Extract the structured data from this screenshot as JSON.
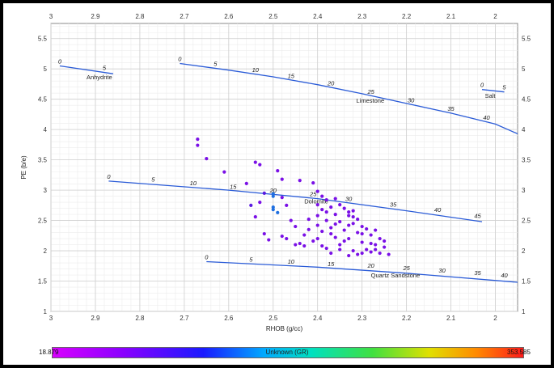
{
  "chart_data": {
    "type": "scatter",
    "title": "",
    "xlabel": "RHOB (g/cc)",
    "ylabel": "PE (b/e)",
    "xlim": [
      3.0,
      1.95
    ],
    "ylim": [
      1.0,
      5.75
    ],
    "x_ticks": [
      "3",
      "2.9",
      "2.8",
      "2.7",
      "2.6",
      "2.5",
      "2.4",
      "2.3",
      "2.2",
      "2.1",
      "2"
    ],
    "y_ticks": [
      "1",
      "1.5",
      "2",
      "2.5",
      "3",
      "3.5",
      "4",
      "4.5",
      "5",
      "5.5"
    ],
    "grid": true,
    "lithology_lines": [
      {
        "name": "Anhydrite",
        "points": [
          [
            2.98,
            5.05
          ],
          [
            2.86,
            4.92
          ]
        ],
        "labels": [
          {
            "text": "0",
            "x": 2.98,
            "y": 5.05
          },
          {
            "text": "5",
            "x": 2.88,
            "y": 4.94
          }
        ]
      },
      {
        "name": "Limestone",
        "points": [
          [
            2.71,
            5.09
          ],
          [
            2.6,
            4.98
          ],
          [
            2.5,
            4.87
          ],
          [
            2.4,
            4.74
          ],
          [
            2.3,
            4.59
          ],
          [
            2.2,
            4.43
          ],
          [
            2.1,
            4.27
          ],
          [
            2.0,
            4.09
          ],
          [
            1.95,
            3.93
          ]
        ],
        "labels": [
          {
            "text": "0",
            "x": 2.71,
            "y": 5.09
          },
          {
            "text": "5",
            "x": 2.63,
            "y": 5.01
          },
          {
            "text": "10",
            "x": 2.54,
            "y": 4.91
          },
          {
            "text": "15",
            "x": 2.46,
            "y": 4.81
          },
          {
            "text": "20",
            "x": 2.37,
            "y": 4.69
          },
          {
            "text": "25",
            "x": 2.28,
            "y": 4.55
          },
          {
            "text": "30",
            "x": 2.19,
            "y": 4.41
          },
          {
            "text": "35",
            "x": 2.1,
            "y": 4.27
          },
          {
            "text": "40",
            "x": 2.02,
            "y": 4.12
          }
        ]
      },
      {
        "name": "Salt",
        "points": [
          [
            2.03,
            4.66
          ],
          [
            1.98,
            4.62
          ]
        ],
        "labels": [
          {
            "text": "0",
            "x": 2.03,
            "y": 4.66
          },
          {
            "text": "5",
            "x": 1.98,
            "y": 4.62
          }
        ]
      },
      {
        "name": "Dolomite",
        "points": [
          [
            2.87,
            3.15
          ],
          [
            2.6,
            3.0
          ],
          [
            2.4,
            2.86
          ],
          [
            2.2,
            2.66
          ],
          [
            2.03,
            2.48
          ]
        ],
        "labels": [
          {
            "text": "0",
            "x": 2.87,
            "y": 3.15
          },
          {
            "text": "5",
            "x": 2.77,
            "y": 3.1
          },
          {
            "text": "10",
            "x": 2.68,
            "y": 3.04
          },
          {
            "text": "15",
            "x": 2.59,
            "y": 2.98
          },
          {
            "text": "20",
            "x": 2.5,
            "y": 2.92
          },
          {
            "text": "25",
            "x": 2.41,
            "y": 2.86
          },
          {
            "text": "30",
            "x": 2.33,
            "y": 2.78
          },
          {
            "text": "35",
            "x": 2.23,
            "y": 2.69
          },
          {
            "text": "40",
            "x": 2.13,
            "y": 2.6
          },
          {
            "text": "45",
            "x": 2.04,
            "y": 2.5
          }
        ]
      },
      {
        "name": "Quartz Sandstone",
        "points": [
          [
            2.65,
            1.82
          ],
          [
            2.4,
            1.73
          ],
          [
            2.2,
            1.63
          ],
          [
            1.95,
            1.48
          ]
        ],
        "labels": [
          {
            "text": "0",
            "x": 2.65,
            "y": 1.82
          },
          {
            "text": "5",
            "x": 2.55,
            "y": 1.78
          },
          {
            "text": "10",
            "x": 2.46,
            "y": 1.75
          },
          {
            "text": "15",
            "x": 2.37,
            "y": 1.71
          },
          {
            "text": "20",
            "x": 2.28,
            "y": 1.68
          },
          {
            "text": "25",
            "x": 2.2,
            "y": 1.64
          },
          {
            "text": "30",
            "x": 2.12,
            "y": 1.6
          },
          {
            "text": "35",
            "x": 2.04,
            "y": 1.56
          },
          {
            "text": "40",
            "x": 1.98,
            "y": 1.52
          }
        ]
      }
    ],
    "line_color": "#2a5bd7",
    "colorbar": {
      "min": "18.879",
      "max": "353.585",
      "title": "Unknown (GR)"
    },
    "series": [
      {
        "points": [
          [
            2.67,
            3.84,
            0.3
          ],
          [
            2.67,
            3.74,
            0.3
          ],
          [
            2.65,
            3.52,
            0.3
          ],
          [
            2.61,
            3.3,
            0.3
          ],
          [
            2.54,
            3.46,
            0.3
          ],
          [
            2.53,
            3.42,
            0.3
          ],
          [
            2.49,
            3.32,
            0.3
          ],
          [
            2.48,
            3.18,
            0.3
          ],
          [
            2.44,
            3.16,
            0.3
          ],
          [
            2.41,
            3.12,
            0.3
          ],
          [
            2.56,
            3.11,
            0.3
          ],
          [
            2.55,
            2.75,
            0.4
          ],
          [
            2.54,
            2.56,
            0.3
          ],
          [
            2.52,
            2.95,
            0.4
          ],
          [
            2.53,
            2.8,
            0.3
          ],
          [
            2.5,
            2.94,
            0.7
          ],
          [
            2.5,
            2.9,
            0.7
          ],
          [
            2.5,
            2.72,
            0.5
          ],
          [
            2.5,
            2.68,
            0.65
          ],
          [
            2.49,
            2.63,
            0.55
          ],
          [
            2.48,
            2.88,
            0.35
          ],
          [
            2.47,
            2.75,
            0.35
          ],
          [
            2.46,
            2.5,
            0.35
          ],
          [
            2.47,
            2.2,
            0.35
          ],
          [
            2.45,
            2.1,
            0.35
          ],
          [
            2.44,
            2.12,
            0.35
          ],
          [
            2.43,
            2.08,
            0.35
          ],
          [
            2.52,
            2.28,
            0.35
          ],
          [
            2.51,
            2.18,
            0.35
          ],
          [
            2.48,
            2.24,
            0.35
          ],
          [
            2.45,
            2.4,
            0.35
          ],
          [
            2.43,
            2.26,
            0.35
          ],
          [
            2.42,
            2.52,
            0.35
          ],
          [
            2.42,
            2.35,
            0.35
          ],
          [
            2.41,
            2.16,
            0.35
          ],
          [
            2.4,
            2.98,
            0.3
          ],
          [
            2.4,
            2.76,
            0.3
          ],
          [
            2.4,
            2.58,
            0.3
          ],
          [
            2.4,
            2.42,
            0.3
          ],
          [
            2.39,
            2.68,
            0.3
          ],
          [
            2.39,
            2.32,
            0.3
          ],
          [
            2.38,
            2.84,
            0.3
          ],
          [
            2.38,
            2.5,
            0.3
          ],
          [
            2.38,
            2.04,
            0.3
          ],
          [
            2.37,
            2.72,
            0.3
          ],
          [
            2.37,
            2.38,
            0.3
          ],
          [
            2.36,
            2.6,
            0.3
          ],
          [
            2.36,
            2.22,
            0.3
          ],
          [
            2.35,
            2.48,
            0.3
          ],
          [
            2.35,
            2.1,
            0.3
          ],
          [
            2.34,
            2.7,
            0.3
          ],
          [
            2.34,
            2.34,
            0.3
          ],
          [
            2.33,
            2.58,
            0.3
          ],
          [
            2.33,
            2.2,
            0.3
          ],
          [
            2.32,
            2.66,
            0.3
          ],
          [
            2.32,
            2.45,
            0.3
          ],
          [
            2.32,
            2.0,
            0.3
          ],
          [
            2.31,
            2.52,
            0.3
          ],
          [
            2.31,
            2.3,
            0.3
          ],
          [
            2.31,
            1.94,
            0.3
          ],
          [
            2.3,
            2.4,
            0.3
          ],
          [
            2.3,
            2.14,
            0.3
          ],
          [
            2.29,
            2.36,
            0.3
          ],
          [
            2.29,
            2.02,
            0.3
          ],
          [
            2.28,
            2.26,
            0.3
          ],
          [
            2.28,
            1.98,
            0.3
          ],
          [
            2.27,
            2.34,
            0.3
          ],
          [
            2.27,
            2.1,
            0.3
          ],
          [
            2.26,
            2.2,
            0.3
          ],
          [
            2.26,
            1.96,
            0.3
          ],
          [
            2.25,
            2.06,
            0.3
          ],
          [
            2.24,
            1.94,
            0.3
          ],
          [
            2.36,
            2.86,
            0.3
          ],
          [
            2.35,
            2.76,
            0.3
          ],
          [
            2.33,
            2.64,
            0.3
          ],
          [
            2.32,
            2.56,
            0.3
          ],
          [
            2.39,
            2.9,
            0.3
          ],
          [
            2.38,
            2.64,
            0.3
          ],
          [
            2.37,
            2.28,
            0.3
          ],
          [
            2.36,
            2.44,
            0.3
          ],
          [
            2.34,
            2.16,
            0.3
          ],
          [
            2.33,
            2.42,
            0.3
          ],
          [
            2.3,
            2.28,
            0.3
          ],
          [
            2.28,
            2.12,
            0.3
          ],
          [
            2.4,
            2.2,
            0.3
          ],
          [
            2.39,
            2.08,
            0.3
          ],
          [
            2.37,
            1.96,
            0.3
          ],
          [
            2.35,
            2.02,
            0.3
          ],
          [
            2.33,
            1.92,
            0.3
          ],
          [
            2.3,
            1.96,
            0.3
          ],
          [
            2.27,
            2.02,
            0.3
          ],
          [
            2.25,
            2.16,
            0.3
          ]
        ]
      }
    ]
  }
}
